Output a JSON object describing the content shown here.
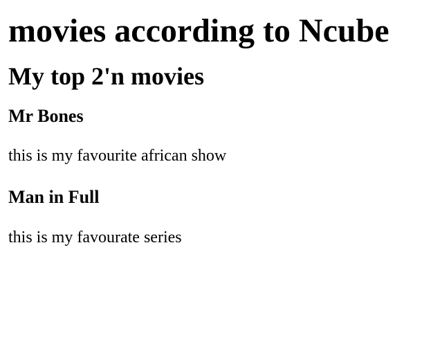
{
  "page": {
    "title": "movies according to Ncube",
    "subtitle": "My top 2'n movies"
  },
  "movies": [
    {
      "title": "Mr Bones",
      "description": "this is my favourite african show"
    },
    {
      "title": "Man in Full",
      "description": "this is my favourate series"
    }
  ]
}
